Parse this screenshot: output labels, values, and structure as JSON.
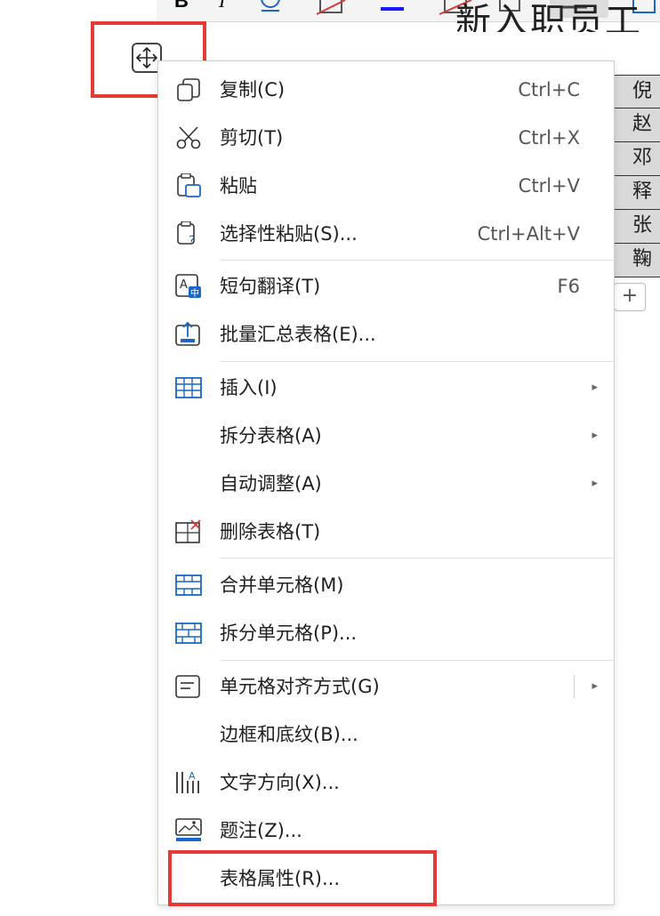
{
  "document": {
    "title_fragment": "新入职员工",
    "table_cells": [
      "倪",
      "赵",
      "邓",
      "释",
      "张",
      "鞠"
    ],
    "add_row_label": "+"
  },
  "menu": {
    "items": [
      {
        "label": "复制(C)",
        "shortcut": "Ctrl+C",
        "icon": "copy-icon"
      },
      {
        "label": "剪切(T)",
        "shortcut": "Ctrl+X",
        "icon": "scissors-icon"
      },
      {
        "label": "粘贴",
        "shortcut": "Ctrl+V",
        "icon": "paste-icon"
      },
      {
        "label": "选择性粘贴(S)...",
        "shortcut": "Ctrl+Alt+V",
        "icon": "paste-special-icon"
      },
      {
        "label": "短句翻译(T)",
        "shortcut": "F6",
        "icon": "translate-icon"
      },
      {
        "label": "批量汇总表格(E)...",
        "shortcut": "",
        "icon": "summarize-tables-icon"
      },
      {
        "label": "插入(I)",
        "shortcut": "",
        "icon": "insert-table-icon",
        "submenu": true
      },
      {
        "label": "拆分表格(A)",
        "shortcut": "",
        "icon": "",
        "submenu": true
      },
      {
        "label": "自动调整(A)",
        "shortcut": "",
        "icon": "",
        "submenu": true
      },
      {
        "label": "删除表格(T)",
        "shortcut": "",
        "icon": "delete-table-icon"
      },
      {
        "label": "合并单元格(M)",
        "shortcut": "",
        "icon": "merge-cells-icon"
      },
      {
        "label": "拆分单元格(P)...",
        "shortcut": "",
        "icon": "split-cells-icon"
      },
      {
        "label": "单元格对齐方式(G)",
        "shortcut": "",
        "icon": "cell-align-icon",
        "submenu": true
      },
      {
        "label": "边框和底纹(B)...",
        "shortcut": "",
        "icon": ""
      },
      {
        "label": "文字方向(X)...",
        "shortcut": "",
        "icon": "text-direction-icon"
      },
      {
        "label": "题注(Z)...",
        "shortcut": "",
        "icon": "caption-icon"
      },
      {
        "label": "表格属性(R)...",
        "shortcut": "",
        "icon": ""
      }
    ]
  },
  "colors": {
    "highlight_box": "#e53935",
    "icon_blue": "#1a66c9",
    "icon_red": "#d43b3b"
  }
}
